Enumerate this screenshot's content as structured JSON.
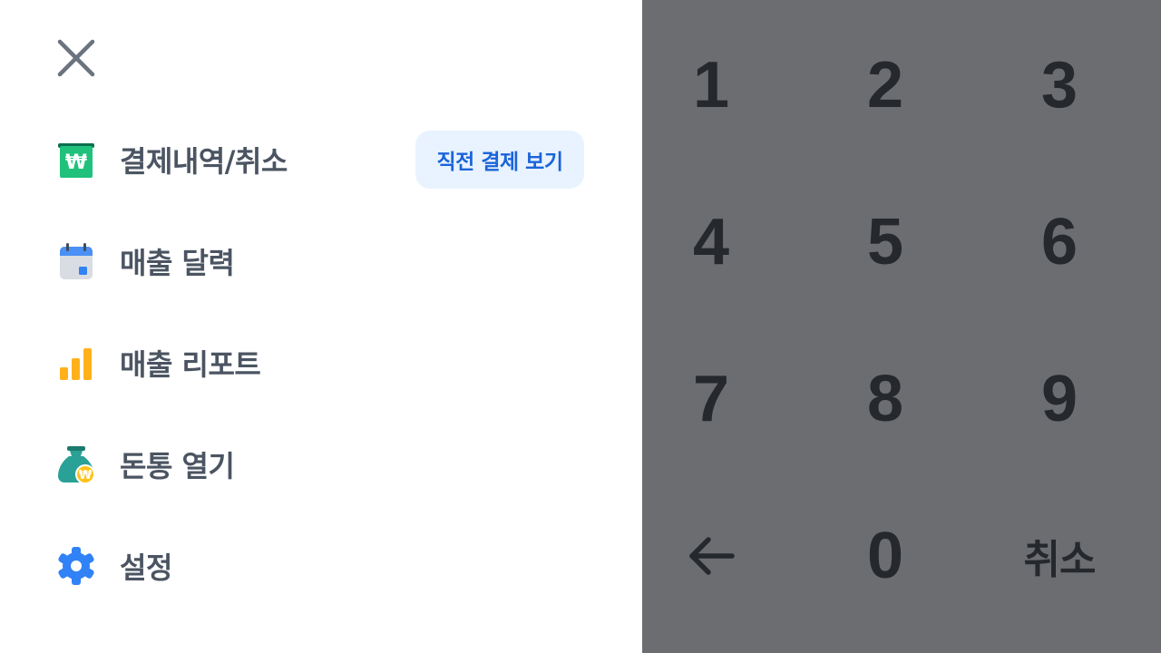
{
  "drawer": {
    "close_icon": "close-icon",
    "items": [
      {
        "label": "결제내역/취소",
        "icon": "won-receipt-icon",
        "color": "#12b886"
      },
      {
        "label": "매출 달력",
        "icon": "calendar-icon",
        "color": "#3182f6"
      },
      {
        "label": "매출 리포트",
        "icon": "bar-chart-icon",
        "color": "#ffb11b"
      },
      {
        "label": "돈통 열기",
        "icon": "money-bag-icon",
        "color": "#20a39e"
      },
      {
        "label": "설정",
        "icon": "gear-icon",
        "color": "#3182f6"
      }
    ],
    "recent_payment_button": "직전 결제 보기"
  },
  "keypad": {
    "keys": [
      "1",
      "2",
      "3",
      "4",
      "5",
      "6",
      "7",
      "8",
      "9",
      "←",
      "0",
      "취소"
    ],
    "backspace_icon": "back-arrow-icon",
    "background": "#6c6d70"
  }
}
